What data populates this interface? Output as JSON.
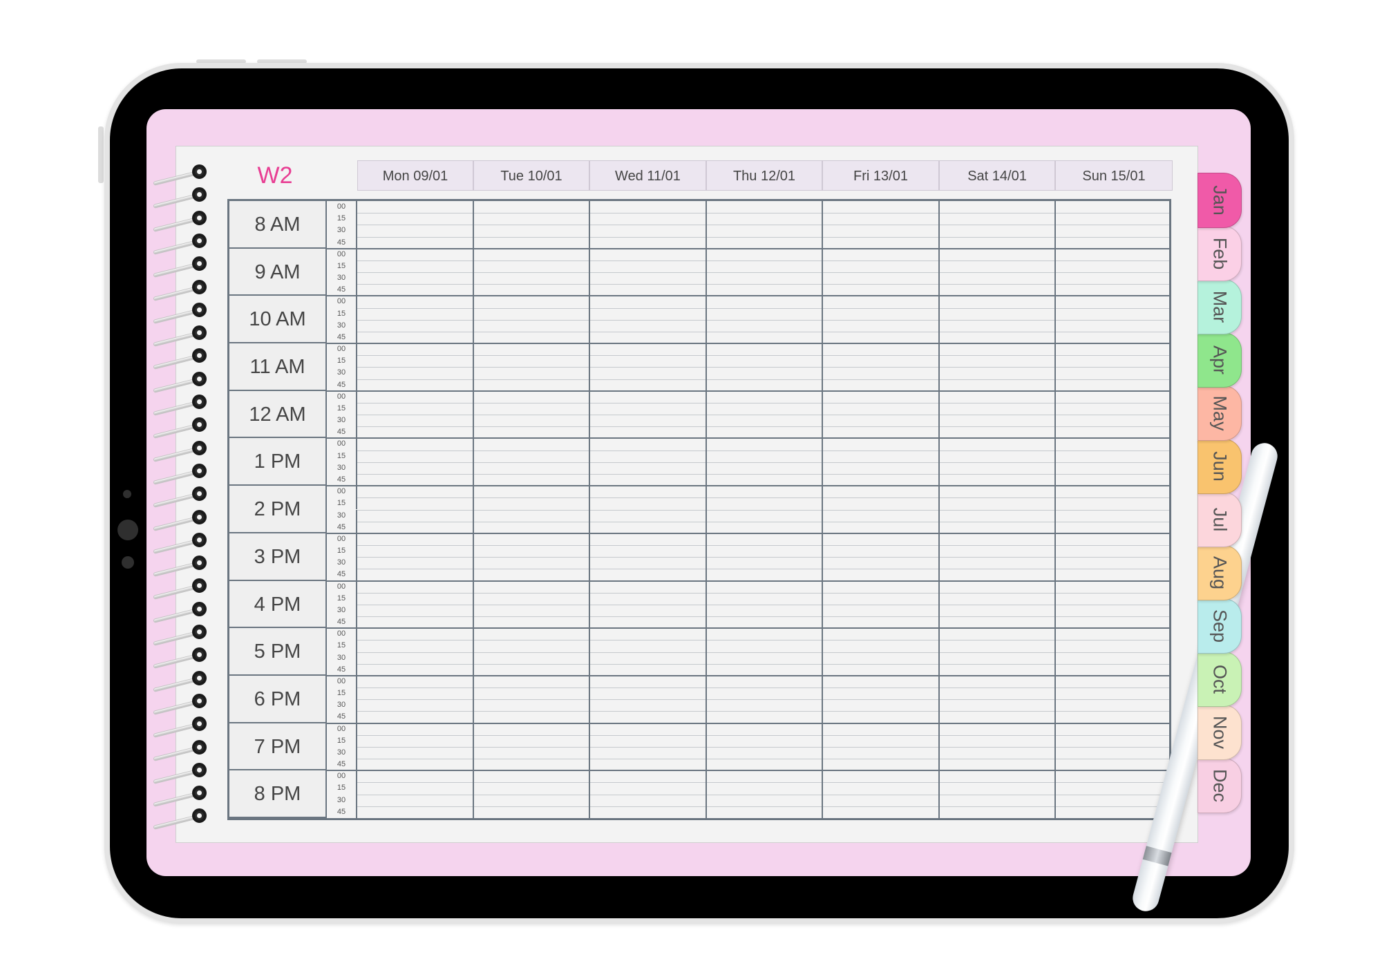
{
  "planner": {
    "week_label": "W2",
    "days": [
      "Mon 09/01",
      "Tue 10/01",
      "Wed 11/01",
      "Thu 12/01",
      "Fri 13/01",
      "Sat 14/01",
      "Sun 15/01"
    ],
    "hours": [
      "8 AM",
      "9 AM",
      "10 AM",
      "11 AM",
      "12 AM",
      "1 PM",
      "2 PM",
      "3 PM",
      "4 PM",
      "5 PM",
      "6 PM",
      "7 PM",
      "8 PM"
    ],
    "minutes": [
      "00",
      "15",
      "30",
      "45"
    ]
  },
  "month_tabs": [
    {
      "label": "Jan",
      "color": "#f05aa8"
    },
    {
      "label": "Feb",
      "color": "#fbd0e6"
    },
    {
      "label": "Mar",
      "color": "#b5f2dc"
    },
    {
      "label": "Apr",
      "color": "#8fe68c"
    },
    {
      "label": "May",
      "color": "#fdb7a4"
    },
    {
      "label": "Jun",
      "color": "#f9c36e"
    },
    {
      "label": "Jul",
      "color": "#fcd6dc"
    },
    {
      "label": "Aug",
      "color": "#fdd28e"
    },
    {
      "label": "Sep",
      "color": "#b9ecec"
    },
    {
      "label": "Oct",
      "color": "#c9f2b5"
    },
    {
      "label": "Nov",
      "color": "#fde2cf"
    },
    {
      "label": "Dec",
      "color": "#f8cfe3"
    }
  ],
  "colors": {
    "screen_background": "#f5d4ee",
    "week_label": "#e83e93",
    "grid_lines": "#6a7580"
  }
}
